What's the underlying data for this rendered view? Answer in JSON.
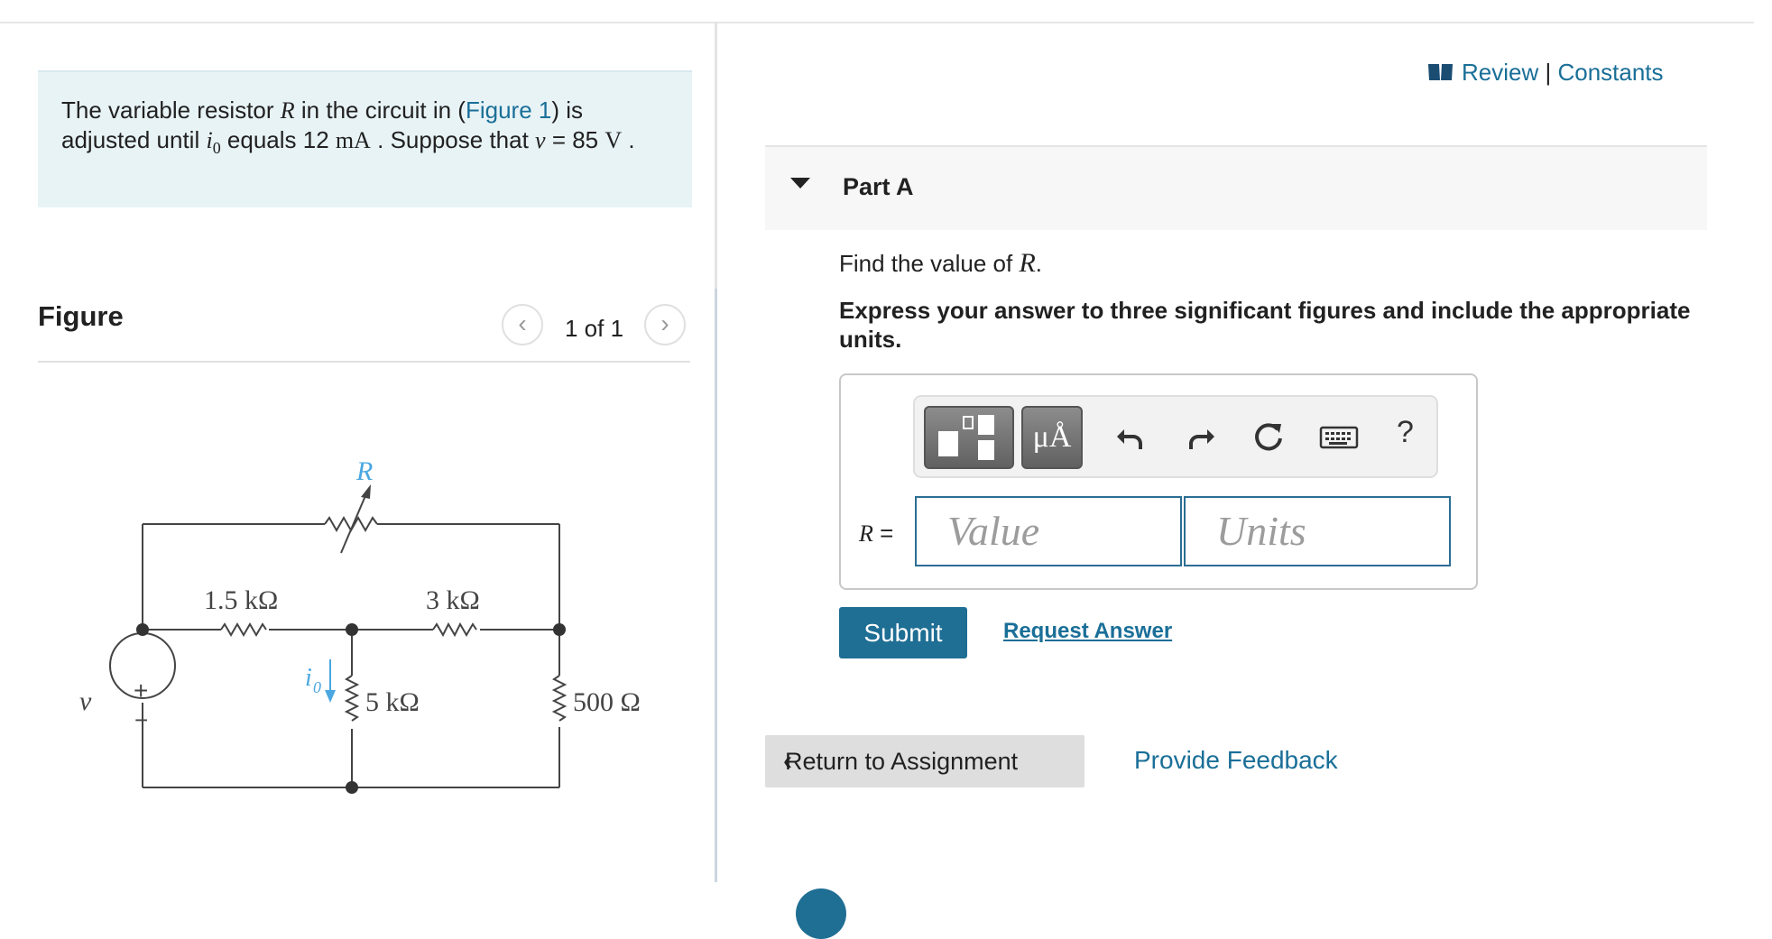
{
  "problem": {
    "t1": "The variable resistor ",
    "R": "R",
    "t2": " in the circuit in (",
    "figure_link": "Figure 1",
    "t3": ") is adjusted until ",
    "i0": "i",
    "i0_sub": "0",
    "t4": " equals 12 ",
    "unit_mA": "mA",
    "t5": " . Suppose that ",
    "v": "v",
    "t6": " = 85 ",
    "unit_V": "V",
    "t7": " ."
  },
  "figure": {
    "heading": "Figure",
    "counter": "1 of 1",
    "prev_glyph": "‹",
    "next_glyph": "›",
    "circuit": {
      "R_label": "R",
      "r1": "1.5 kΩ",
      "r2": "3 kΩ",
      "r3": "5 kΩ",
      "r4": "500 Ω",
      "source_label": "v",
      "current_label": "i",
      "current_sub": "0",
      "plus": "+",
      "minus": "−"
    }
  },
  "links": {
    "review": "Review",
    "separator": " | ",
    "constants": "Constants"
  },
  "part": {
    "title": "Part A",
    "find_pre": "Find the value of ",
    "find_var": "R",
    "find_post": ".",
    "instruction": "Express your answer to three significant figures and include the appropriate units."
  },
  "answer": {
    "var_label": "R",
    "equals": " =",
    "value_placeholder": "Value",
    "units_placeholder": "Units",
    "units_button": "μÅ",
    "help": "?"
  },
  "actions": {
    "submit": "Submit",
    "request_answer": "Request Answer",
    "return": "Return to Assignment",
    "return_icon": "‹",
    "feedback": "Provide Feedback"
  },
  "colors": {
    "link": "#1a6f98",
    "primary_button": "#1f6e94",
    "problem_bg": "#e8f3f6",
    "circuit_accent": "#4aa7e0"
  }
}
